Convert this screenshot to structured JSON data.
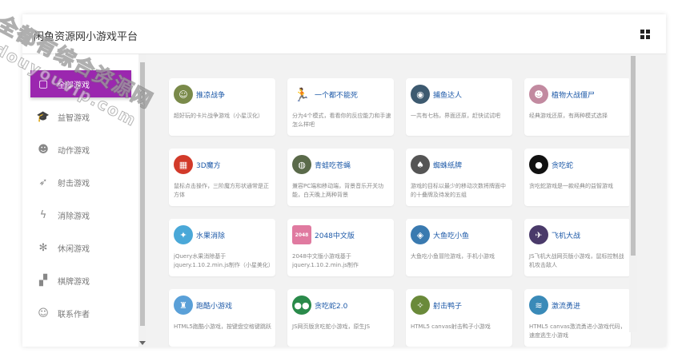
{
  "watermark": {
    "line1": "全都有综合资源网",
    "line2": "douyouvip.com"
  },
  "header": {
    "title": "闲鱼资源网小游戏平台",
    "window_icon": "windows-icon"
  },
  "sidebar": {
    "accent": "#9b27af",
    "items": [
      {
        "label": "全部游戏",
        "icon": "twitch-icon",
        "glyph": "▢"
      },
      {
        "label": "益智游戏",
        "icon": "graduation-cap-icon",
        "glyph": "🎓"
      },
      {
        "label": "动作游戏",
        "icon": "reddit-icon",
        "glyph": "☻"
      },
      {
        "label": "射击游戏",
        "icon": "rocket-icon",
        "glyph": "➶"
      },
      {
        "label": "消除游戏",
        "icon": "lightning-icon",
        "glyph": "ϟ"
      },
      {
        "label": "休闲游戏",
        "icon": "butterfly-icon",
        "glyph": "✻"
      },
      {
        "label": "棋牌游戏",
        "icon": "chessboard-icon",
        "glyph": "▞"
      },
      {
        "label": "联系作者",
        "icon": "user-icon",
        "glyph": "☺"
      }
    ]
  },
  "games": [
    {
      "title": "推凉战争",
      "desc": "超好玩的卡片战争游戏（小星汉化）",
      "icon": "avatar-icon",
      "color": "#7a8a4a",
      "glyph": "☺"
    },
    {
      "title": "一个都不能死",
      "desc": "分为4个模式，看看你的反应能力和手速怎么样吧",
      "icon": "running-man-icon",
      "color": "#ffffff",
      "glyph": "🏃"
    },
    {
      "title": "捕鱼达人",
      "desc": "一共有七档，界面还原，赶快试试吧",
      "icon": "fish-icon",
      "color": "#3d5a70",
      "glyph": "◉"
    },
    {
      "title": "植物大战僵尸",
      "desc": "经典游戏还原，有两种模式选择",
      "icon": "zombie-icon",
      "color": "#c28aa0",
      "glyph": "☻"
    },
    {
      "title": "3D魔方",
      "desc": "鼠标点击操作，三阶魔方形状通常是正方体",
      "icon": "cube-icon",
      "color": "#d23a2a",
      "glyph": "▦"
    },
    {
      "title": "青蛙吃苍蝇",
      "desc": "兼容PC端和移动端，背景音乐开关功能，白天晚上两种背景",
      "icon": "frog-icon",
      "color": "#5a6a4a",
      "glyph": "◍"
    },
    {
      "title": "蜘蛛纸牌",
      "desc": "游戏的目标以最少的移动次数将牌面中的十叠牌及待发的五组",
      "icon": "cards-icon",
      "color": "#555555",
      "glyph": "♠"
    },
    {
      "title": "贪吃蛇",
      "desc": "贪吃蛇游戏是一款经典的益智游戏",
      "icon": "snake-icon",
      "color": "#111111",
      "glyph": "●"
    },
    {
      "title": "水果消除",
      "desc": "jQuery水果消除基于jquery.1.10.2.min.js制作（小星美化）",
      "icon": "fruit-icon",
      "color": "#4aa8d8",
      "glyph": "✦"
    },
    {
      "title": "2048中文版",
      "desc": "2048中文版小游戏基于jquery.1.10.2.min.js制作",
      "icon": "number-2048-icon",
      "color": "#e07aa0",
      "glyph": "2048"
    },
    {
      "title": "大鱼吃小鱼",
      "desc": "大鱼吃小鱼冒险游戏，手机小游戏",
      "icon": "shark-icon",
      "color": "#3a7ab0",
      "glyph": "◈"
    },
    {
      "title": "飞机大战",
      "desc": "JS飞机大战网页版小游戏，鼠标控制战机攻击敌人",
      "icon": "plane-icon",
      "color": "#4a3a6a",
      "glyph": "✈"
    },
    {
      "title": "跑酷小游戏",
      "desc": "HTML5跑酷小游戏，按键盘空格键跳跃",
      "icon": "runner-icon",
      "color": "#5aa0d8",
      "glyph": "♜"
    },
    {
      "title": "贪吃蛇2.0",
      "desc": "JS网页版贪吃蛇小游戏，原生JS",
      "icon": "snake-eyes-icon",
      "color": "#2a8a4a",
      "glyph": "●●"
    },
    {
      "title": "射击鸭子",
      "desc": "HTML5 canvas射击鸭子小游戏",
      "icon": "duck-icon",
      "color": "#6a8a3a",
      "glyph": "✧"
    },
    {
      "title": "激流勇进",
      "desc": "HTML5 canvas激流勇进小游戏代码，速度逃生小游戏",
      "icon": "boat-icon",
      "color": "#3a8ab8",
      "glyph": "≋"
    }
  ]
}
